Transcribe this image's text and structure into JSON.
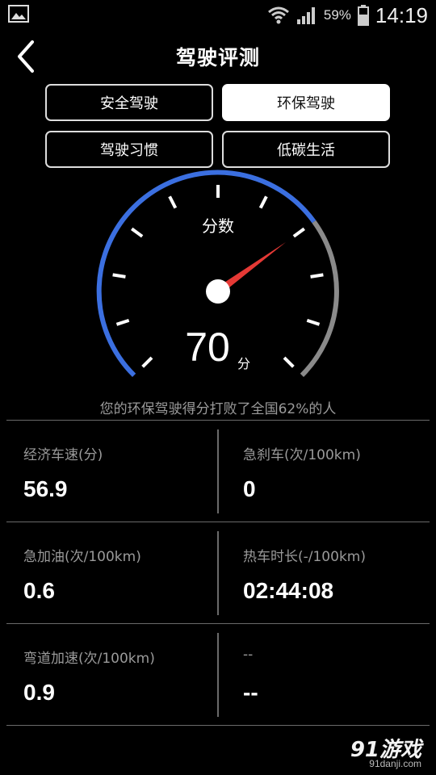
{
  "status_bar": {
    "battery_text": "59%",
    "time": "14:19",
    "icons": [
      "gallery-icon",
      "wifi-icon",
      "signal-icon",
      "battery-icon"
    ]
  },
  "header": {
    "title": "驾驶评测",
    "back_icon": "chevron-left-icon"
  },
  "categories": [
    {
      "label": "安全驾驶",
      "active": false
    },
    {
      "label": "环保驾驶",
      "active": true
    },
    {
      "label": "驾驶习惯",
      "active": false
    },
    {
      "label": "低碳生活",
      "active": false
    }
  ],
  "gauge": {
    "label": "分数",
    "score": "70",
    "unit": "分",
    "value": 70,
    "min": 0,
    "max": 100,
    "colors": {
      "active_arc": "#3b6fe0",
      "inactive_arc": "#8a8a8a",
      "needle": "#e53935"
    }
  },
  "summary": "您的环保驾驶得分打败了全国62%的人",
  "stats": [
    {
      "label": "经济车速(分)",
      "value": "56.9"
    },
    {
      "label": "急刹车(次/100km)",
      "value": "0"
    },
    {
      "label": "急加油(次/100km)",
      "value": "0.6"
    },
    {
      "label": "热车时长(-/100km)",
      "value": "02:44:08"
    },
    {
      "label": "弯道加速(次/100km)",
      "value": "0.9"
    },
    {
      "label": "--",
      "value": "--"
    }
  ],
  "watermark": {
    "logo": "91游戏",
    "url": "91danji.com"
  }
}
